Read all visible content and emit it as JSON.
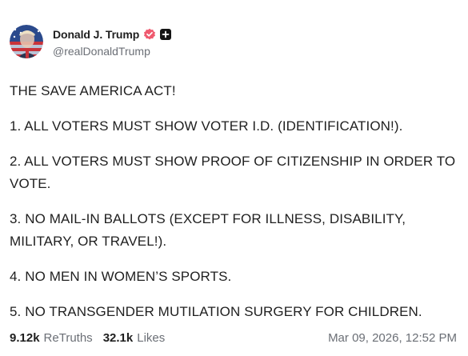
{
  "author": {
    "display_name": "Donald J. Trump",
    "handle": "@realDonaldTrump",
    "avatar_icon": "avatar-image",
    "verified_icon": "verified-badge-icon",
    "plus_icon": "plus-badge-icon"
  },
  "post": {
    "paragraphs": [
      "THE SAVE AMERICA ACT!",
      "1. ALL VOTERS MUST SHOW VOTER I.D. (IDENTIFICATION!).",
      "2. ALL VOTERS MUST SHOW PROOF OF CITIZENSHIP IN ORDER TO VOTE.",
      "3. NO MAIL-IN BALLOTS (EXCEPT FOR ILLNESS, DISABILITY, MILITARY, OR TRAVEL!).",
      "4. NO MEN IN WOMEN’S SPORTS.",
      "5. NO TRANSGENDER MUTILATION SURGERY FOR CHILDREN."
    ]
  },
  "stats": {
    "retruths_count": "9.12k",
    "retruths_label": "ReTruths",
    "likes_count": "32.1k",
    "likes_label": "Likes",
    "timestamp": "Mar 09, 2026, 12:52 PM"
  },
  "colors": {
    "verified_badge": "#ef5a6f",
    "text_primary": "#1f1f1f",
    "text_secondary": "#6b6f76"
  }
}
